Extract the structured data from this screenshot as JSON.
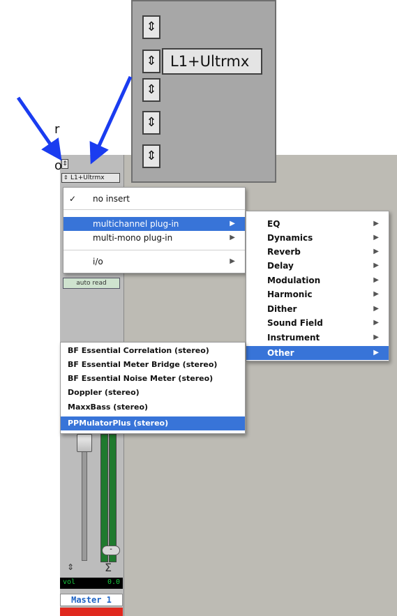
{
  "zoom": {
    "insert_label": "L1+Ultrmx",
    "slot_glyph": "⇕"
  },
  "left_text": {
    "line1": "r",
    "line2": "o"
  },
  "strip": {
    "insert_label": "L1+Ultrmx",
    "slot_glyph": "⇕",
    "auto_mode": "auto read",
    "vol_label": "vol",
    "vol_value": "0.0",
    "track_name": "Master 1",
    "sigma": "Σ",
    "arrows": "⇕",
    "oval": "-"
  },
  "menu_insert": {
    "check": "✓",
    "items": [
      {
        "label": "no insert"
      },
      {
        "label": "multichannel plug-in"
      },
      {
        "label": "multi-mono plug-in"
      },
      {
        "label": "i/o"
      }
    ]
  },
  "menu_category": {
    "items": [
      {
        "label": "EQ"
      },
      {
        "label": "Dynamics"
      },
      {
        "label": "Reverb"
      },
      {
        "label": "Delay"
      },
      {
        "label": "Modulation"
      },
      {
        "label": "Harmonic"
      },
      {
        "label": "Dither"
      },
      {
        "label": "Sound Field"
      },
      {
        "label": "Instrument"
      },
      {
        "label": "Other"
      }
    ]
  },
  "menu_plugins": {
    "items": [
      {
        "label": "BF Essential Correlation (stereo)"
      },
      {
        "label": "BF Essential Meter Bridge (stereo)"
      },
      {
        "label": "BF Essential Noise Meter (stereo)"
      },
      {
        "label": "Doppler (stereo)"
      },
      {
        "label": "MaxxBass (stereo)"
      },
      {
        "label": "PPMulatorPlus (stereo)"
      }
    ]
  },
  "submenu_arrow": "▶",
  "colors": {
    "highlight": "#3874d8",
    "arrow": "#1a3cf0",
    "meter_green": "#1f7a2e",
    "track_red": "#e0281e",
    "track_name_blue": "#1e63c4"
  }
}
